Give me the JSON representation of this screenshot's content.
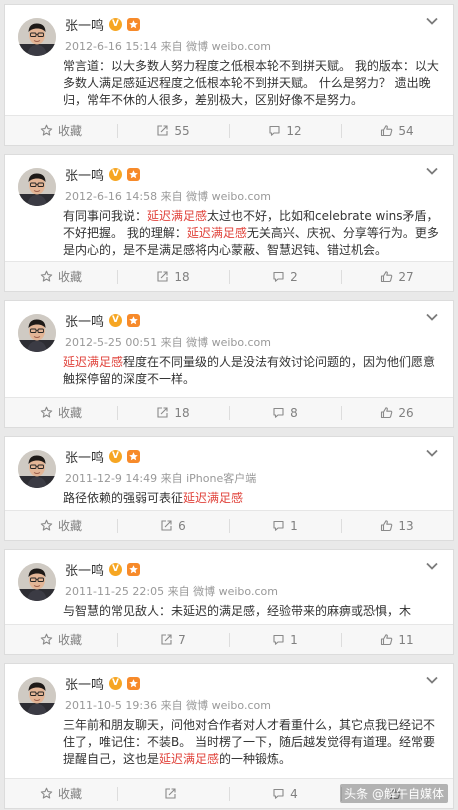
{
  "posts": [
    {
      "author": "张一鸣",
      "meta": "2012-6-16 15:14 来自 微博 weibo.com",
      "segments": [
        {
          "text": "常言道：以大多数人努力程度之低根本轮不到拼天赋。 我的版本：以大多数人满足感延迟程度之低根本轮不到拼天赋。 什么是努力？ 遗出晚归，常年不休的人很多，差别极大，区别好像不是努力。",
          "hl": false
        }
      ],
      "favorite": "收藏",
      "reposts": "55",
      "comments": "12",
      "likes": "54"
    },
    {
      "author": "张一鸣",
      "meta": "2012-6-16 14:58 来自 微博 weibo.com",
      "segments": [
        {
          "text": "有同事问我说：",
          "hl": false
        },
        {
          "text": "延迟满足感",
          "hl": true
        },
        {
          "text": "太过也不好，比如和celebrate wins矛盾，不好把握。 我的理解：",
          "hl": false
        },
        {
          "text": "延迟满足感",
          "hl": true
        },
        {
          "text": "无关高兴、庆祝、分享等行为。更多是内心的，是不是满足感将内心蒙蔽、智慧迟钝、错过机会。",
          "hl": false
        }
      ],
      "favorite": "收藏",
      "reposts": "18",
      "comments": "2",
      "likes": "27"
    },
    {
      "author": "张一鸣",
      "meta": "2012-5-25 00:51 来自 微博 weibo.com",
      "segments": [
        {
          "text": "延迟满足感",
          "hl": true
        },
        {
          "text": "程度在不同量级的人是没法有效讨论问题的，因为他们愿意触探停留的深度不一样。",
          "hl": false
        }
      ],
      "favorite": "收藏",
      "reposts": "18",
      "comments": "8",
      "likes": "26"
    },
    {
      "author": "张一鸣",
      "meta": "2011-12-9 14:49 来自 iPhone客户端",
      "segments": [
        {
          "text": "路径依赖的强弱可表征",
          "hl": false
        },
        {
          "text": "延迟满足感",
          "hl": true
        }
      ],
      "favorite": "收藏",
      "reposts": "6",
      "comments": "1",
      "likes": "13"
    },
    {
      "author": "张一鸣",
      "meta": "2011-11-25 22:05 来自 微博 weibo.com",
      "segments": [
        {
          "text": "与智慧的常见敌人：未延迟的满足感，经验带来的麻痹或恐惧，木",
          "hl": false
        }
      ],
      "favorite": "收藏",
      "reposts": "7",
      "comments": "1",
      "likes": "11"
    },
    {
      "author": "张一鸣",
      "meta": "2011-10-5 19:36 来自 微博 weibo.com",
      "segments": [
        {
          "text": "三年前和朋友聊天，问他对合作者对人才看重什么，其它点我已经记不住了，唯记住：不装B。 当时楞了一下，随后越发觉得有道理。经常要提醒自己，这也是",
          "hl": false
        },
        {
          "text": "延迟满足感",
          "hl": true
        },
        {
          "text": "的一种锻炼。",
          "hl": false
        }
      ],
      "favorite": "收藏",
      "reposts": "",
      "comments": "4",
      "likes": ""
    }
  ],
  "watermark": "头条 @解午自媒体",
  "colors": {
    "background": "#e9e9e9",
    "highlight": "#e0433b",
    "verified_badge": "#f6a623",
    "action_bar": "#f7f7f7"
  },
  "icons": {
    "favorite": "star-icon",
    "repost": "repost-icon",
    "comment": "comment-icon",
    "like": "thumbs-up-icon",
    "menu": "chevron-down-icon",
    "verified": "verified-v-icon",
    "vip": "vip-icon"
  }
}
